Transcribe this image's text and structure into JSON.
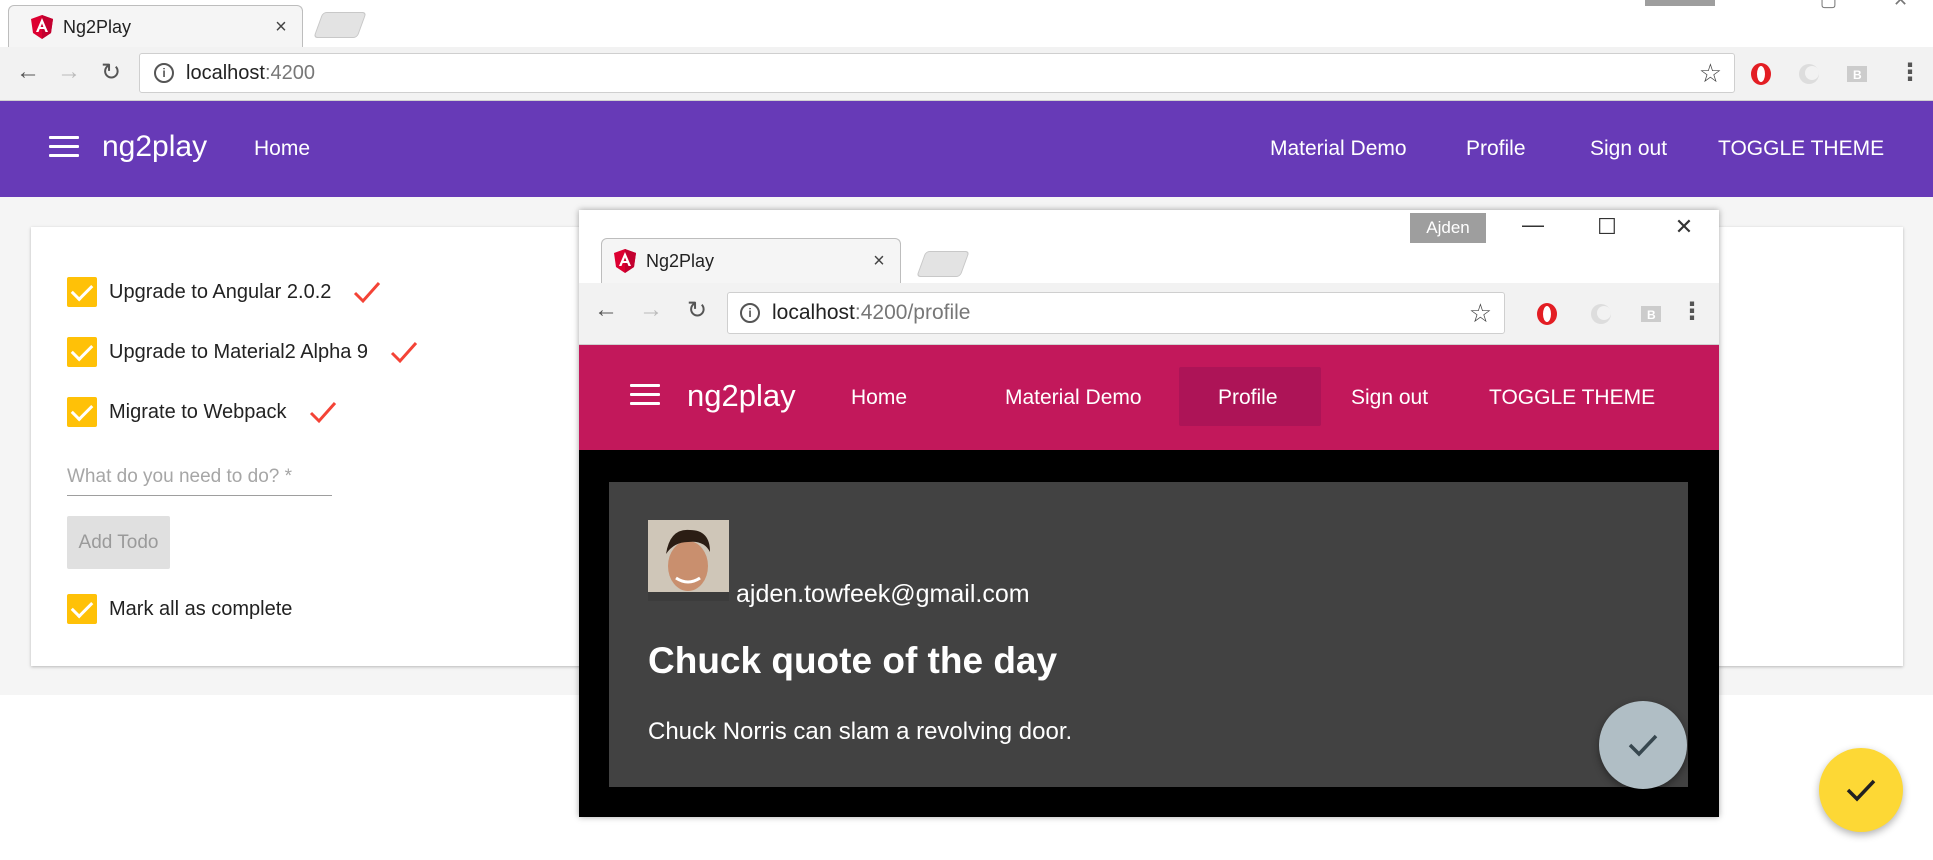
{
  "browser": {
    "tab_title": "Ng2Play",
    "tab_close": "×",
    "url_host": "localhost",
    "url_port": ":4200"
  },
  "app": {
    "brand": "ng2play",
    "nav": {
      "home": "Home",
      "material_demo": "Material Demo",
      "profile": "Profile",
      "sign_out": "Sign out",
      "toggle_theme": "TOGGLE THEME"
    },
    "theme_color": "#673ab7"
  },
  "todos": {
    "items": [
      {
        "label": "Upgrade to Angular 2.0.2",
        "done": true
      },
      {
        "label": "Upgrade to Material2 Alpha 9",
        "done": true
      },
      {
        "label": "Migrate to Webpack",
        "done": true
      }
    ],
    "input_placeholder": "What do you need to do? *",
    "add_button": "Add Todo",
    "mark_all": "Mark all as complete",
    "accent_color": "#ffc107"
  },
  "front_window": {
    "user_chip": "Ajden",
    "tab_title": "Ng2Play",
    "tab_close": "×",
    "url_host": "localhost",
    "url_path": ":4200/profile",
    "brand": "ng2play",
    "nav": {
      "home": "Home",
      "material_demo": "Material Demo",
      "profile": "Profile",
      "sign_out": "Sign out",
      "toggle_theme": "TOGGLE THEME"
    },
    "theme_color": "#c2185b",
    "profile": {
      "email": "ajden.towfeek@gmail.com",
      "quote_title": "Chuck quote of the day",
      "quote": "Chuck Norris can slam a revolving door."
    }
  }
}
